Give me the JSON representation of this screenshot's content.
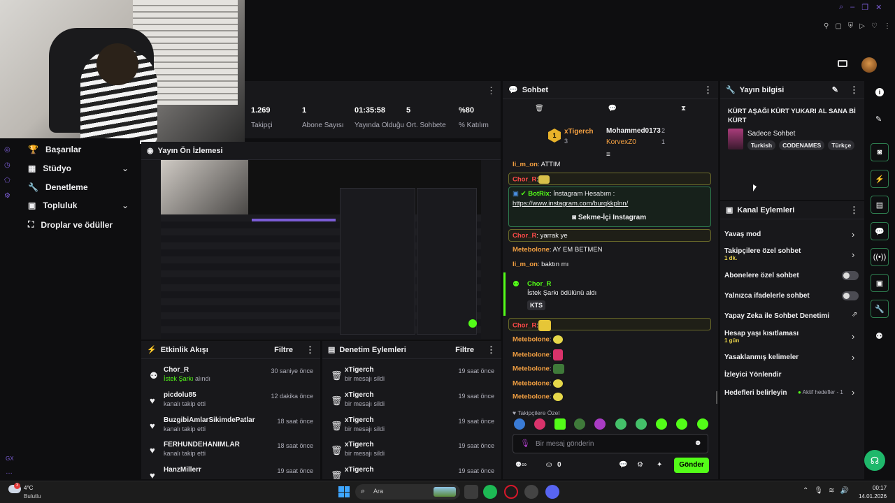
{
  "stats": [
    {
      "value": "1.269",
      "label": "Takipçi"
    },
    {
      "value": "1",
      "label": "Abone Sayısı"
    },
    {
      "value": "01:35:58",
      "label": "Yayında Olduğu"
    },
    {
      "value": "5",
      "label": "Ort. Sohbete"
    },
    {
      "value": "%80",
      "label": "% Katılım"
    }
  ],
  "nav": {
    "items": [
      {
        "label": "Başarılar"
      },
      {
        "label": "Stüdyo"
      },
      {
        "label": "Denetleme"
      },
      {
        "label": "Topluluk"
      },
      {
        "label": "Droplar ve ödüller"
      }
    ]
  },
  "preview": {
    "title": "Yayın Ön İzlemesi"
  },
  "activity": {
    "title": "Etkinlik Akışı",
    "filter": "Filtre",
    "items": [
      {
        "name": "Chor_R",
        "highlight": "İstek Şarkı",
        "sub": " alındı",
        "time": "30 saniye önce"
      },
      {
        "name": "picdolu85",
        "sub": "kanalı takip etti",
        "time": "12 dakika önce"
      },
      {
        "name": "BuzgibiAmlarSikimdePatlar",
        "sub": "kanalı takip etti",
        "time": "18 saat önce"
      },
      {
        "name": "FERHUNDEHANIMLAR",
        "sub": "kanalı takip etti",
        "time": "18 saat önce"
      },
      {
        "name": "HanzMillerr",
        "sub": "",
        "time": "19 saat önce"
      }
    ]
  },
  "moderation": {
    "title": "Denetim Eylemleri",
    "filter": "Filtre",
    "items": [
      {
        "name": "xTigerch",
        "sub": "bir mesajı sildi",
        "time": "19 saat önce"
      },
      {
        "name": "xTigerch",
        "sub": "bir mesajı sildi",
        "time": "19 saat önce"
      },
      {
        "name": "xTigerch",
        "sub": "bir mesajı sildi",
        "time": "19 saat önce"
      },
      {
        "name": "xTigerch",
        "sub": "bir mesajı sildi",
        "time": "19 saat önce"
      },
      {
        "name": "xTigerch",
        "sub": "",
        "time": "19 saat önce"
      }
    ]
  },
  "chat": {
    "title": "Sohbet",
    "leaders": {
      "first": "xTigerch",
      "first_count": "3",
      "second": "Mohammed0173",
      "second_count": "2",
      "third": "KorvexZ0",
      "third_count": "1"
    },
    "lines": [
      {
        "user": "li_m_on",
        "text": ": ATTIM"
      },
      {
        "user": "Chor_R",
        "text": ":"
      },
      {
        "user": "BotRix",
        "text": ": İnstagram Hesabım :",
        "link": "https://www.instagram.com/burqkkplnn/",
        "button": "Sekme-İçi Instagram"
      },
      {
        "user": "Chor_R",
        "text": ": yarrak ye"
      },
      {
        "user": "Metebolone",
        "text": ": AY EM BETMEN"
      },
      {
        "user": "li_m_on",
        "text": ": baktın mı"
      },
      {
        "user": "Chor_R",
        "text": "İstek Şarkı ödülünü aldı",
        "badge": "KTS"
      },
      {
        "user": "Chor_R",
        "text": ":"
      },
      {
        "user": "Metebolone",
        "text": ":"
      },
      {
        "user": "Metebolone",
        "text": ":"
      },
      {
        "user": "Metebolone",
        "text": ":"
      },
      {
        "user": "Metebolone",
        "text": ":"
      },
      {
        "user": "Metebolone",
        "text": ":"
      }
    ],
    "followers_only": "Takipçilere Özel",
    "input_placeholder": "Bir mesaj gönderin",
    "points": "0",
    "send": "Gönder"
  },
  "stream_info": {
    "title": "Yayın bilgisi",
    "stream_title": "KÜRT AŞAĞI KÜRT YUKARI AL SANA Bİ KÜRT",
    "category": "Sadece Sohbet",
    "tags": [
      "Turkish",
      "CODENAMES",
      "Türkçe"
    ]
  },
  "channel_actions": {
    "title": "Kanal Eylemleri",
    "items": [
      {
        "label": "Yavaş mod",
        "sub": ""
      },
      {
        "label": "Takipçilere özel sohbet",
        "sub": "1 dk."
      },
      {
        "label": "Abonelere özel sohbet",
        "sub": ""
      },
      {
        "label": "Yalnızca ifadelerle sohbet",
        "sub": ""
      },
      {
        "label": "Yapay Zeka ile Sohbet Denetimi",
        "sub": ""
      },
      {
        "label": "Hesap yaşı kısıtlaması",
        "sub": "1 gün"
      },
      {
        "label": "Yasaklanmış kelimeler",
        "sub": ""
      },
      {
        "label": "İzleyici Yönlendir",
        "sub": ""
      },
      {
        "label": "Hedefleri belirleyin",
        "sub": ""
      }
    ],
    "goals_status": "Aktif hedefler - 1"
  },
  "taskbar": {
    "weather_temp": "4°C",
    "weather_desc": "Bulutlu",
    "search": "Ara",
    "time": "00:17",
    "date": "14.01.2026",
    "weather_badge": "3"
  },
  "misc": {
    "gx": "GX"
  },
  "colors": {
    "accent": "#53fc18",
    "bg": "#0e0e10",
    "panel": "#18181b"
  }
}
